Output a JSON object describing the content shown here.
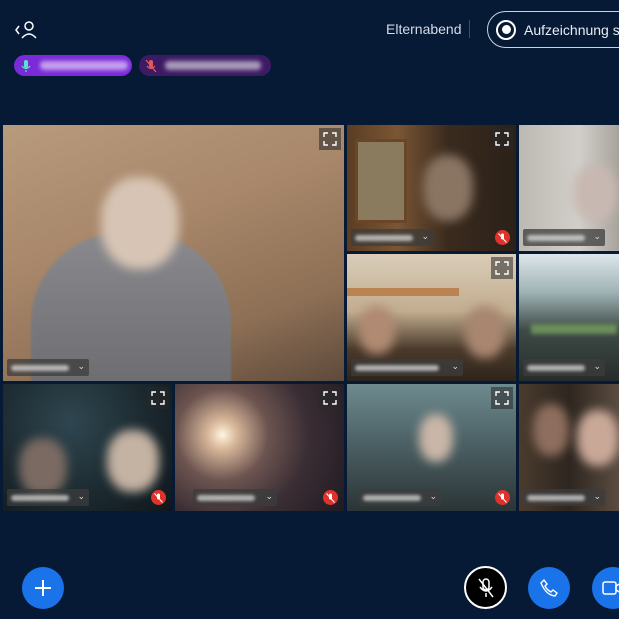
{
  "header": {
    "meeting_title": "Elternabend",
    "record_label": "Aufzeichnung sta"
  },
  "speakers": [
    {
      "state": "speaking"
    },
    {
      "state": "muted"
    }
  ],
  "tiles": [
    {
      "id": "main-speaker",
      "muted": false
    },
    {
      "id": "tile-2",
      "muted": true
    },
    {
      "id": "tile-3",
      "muted": false
    },
    {
      "id": "tile-4",
      "muted": false
    },
    {
      "id": "tile-5",
      "muted": false
    },
    {
      "id": "tile-6",
      "muted": true
    },
    {
      "id": "tile-7",
      "muted": true
    },
    {
      "id": "tile-8",
      "muted": true
    },
    {
      "id": "tile-9",
      "muted": false
    }
  ],
  "colors": {
    "background": "#061a35",
    "accent": "#1a73e8",
    "speaking_chip": "#7a2bd8",
    "muted_chip": "#3d1b64",
    "mute_badge": "#e0322d"
  }
}
